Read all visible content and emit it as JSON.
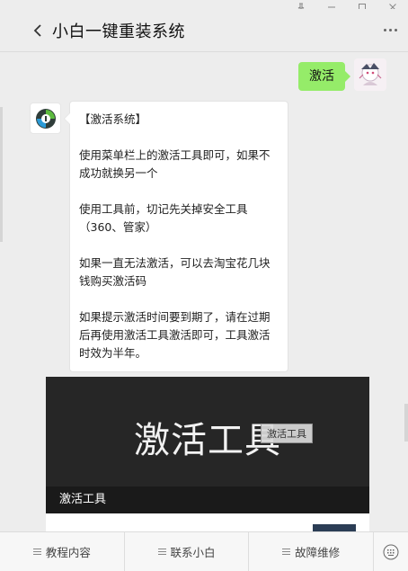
{
  "header": {
    "title": "小白一键重装系统"
  },
  "window": {
    "pin_icon": "pin-icon",
    "minimize_icon": "minimize-icon",
    "maximize_icon": "maximize-icon",
    "close_icon": "close-icon"
  },
  "chat": {
    "outgoing": {
      "text": "激活"
    },
    "incoming": {
      "lines": [
        "【激活系统】",
        "",
        "使用菜单栏上的激活工具即可，如果不成功就换另一个",
        "",
        "使用工具前，切记先关掉安全工具（360、管家）",
        "",
        "如果一直无法激活，可以去淘宝花几块钱购买激活码",
        "",
        "如果提示激活时间要到期了，请在过期后再使用激活工具激活即可，工具激活时效为半年。"
      ]
    },
    "card": {
      "cover_text": "激活工具",
      "tooltip": "激活工具",
      "caption": "激活工具"
    }
  },
  "menu": {
    "items": [
      {
        "label": "教程内容"
      },
      {
        "label": "联系小白"
      },
      {
        "label": "故障维修"
      }
    ]
  },
  "colors": {
    "background": "#ededed",
    "outgoing_bubble": "#95ec69",
    "incoming_bubble": "#ffffff",
    "card_bg": "#262626"
  }
}
